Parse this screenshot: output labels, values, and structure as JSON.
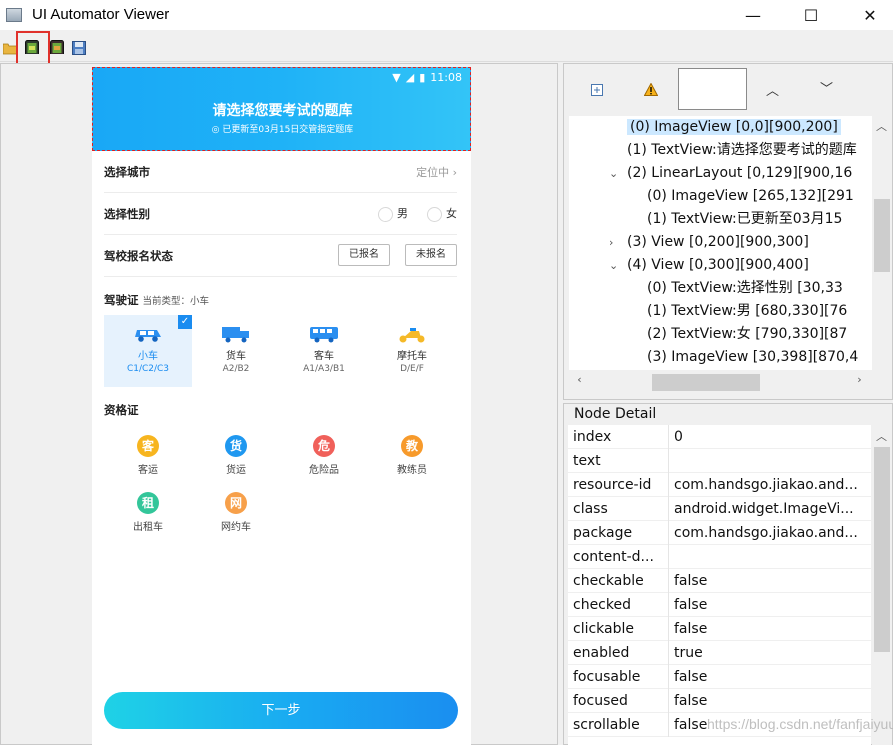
{
  "window": {
    "title": "UI Automator Viewer",
    "minimize": "—",
    "maximize": "☐",
    "close": "✕"
  },
  "toolbar": {
    "items": [
      {
        "name": "open-icon"
      },
      {
        "name": "device-screenshot-icon"
      },
      {
        "name": "device-screenshot-compressed-icon"
      },
      {
        "name": "save-icon"
      }
    ]
  },
  "phone": {
    "status_time": "11:08",
    "header_title": "请选择您要考试的题库",
    "header_sub": "已更新至03月15日交管指定题库",
    "rows": {
      "city_label": "选择城市",
      "city_value": "定位中",
      "gender_label": "选择性别",
      "gender_male": "男",
      "gender_female": "女",
      "school_label": "驾校报名状态",
      "school_btn1": "已报名",
      "school_btn2": "未报名"
    },
    "license": {
      "title": "驾驶证",
      "current": "当前类型：小车",
      "items": [
        {
          "name": "小车",
          "codes": "C1/C2/C3",
          "color": "#2b8ff0",
          "selected": true
        },
        {
          "name": "货车",
          "codes": "A2/B2",
          "color": "#2b8ff0",
          "selected": false
        },
        {
          "name": "客车",
          "codes": "A1/A3/B1",
          "color": "#2b8ff0",
          "selected": false
        },
        {
          "name": "摩托车",
          "codes": "D/E/F",
          "color": "#f5b928",
          "selected": false
        }
      ]
    },
    "qualification": {
      "title": "资格证",
      "items": [
        {
          "char": "客",
          "name": "客运",
          "color": "#f7b51f"
        },
        {
          "char": "货",
          "name": "货运",
          "color": "#1f98f0"
        },
        {
          "char": "危",
          "name": "危险品",
          "color": "#f0605a"
        },
        {
          "char": "教",
          "name": "教练员",
          "color": "#f79a2b"
        },
        {
          "char": "租",
          "name": "出租车",
          "color": "#33c69a"
        },
        {
          "char": "网",
          "name": "网约车",
          "color": "#f7a04a"
        }
      ]
    },
    "next_button": "下一步"
  },
  "tree": {
    "lines": [
      {
        "indent": 3,
        "arrow": "",
        "text": "(0) ImageView [0,0][900,200]",
        "selected": true
      },
      {
        "indent": 3,
        "arrow": "",
        "text": "(1) TextView:请选择您要考试的题库",
        "selected": false
      },
      {
        "indent": 3,
        "arrow": "⌄",
        "text": "(2) LinearLayout [0,129][900,16",
        "selected": false
      },
      {
        "indent": 4,
        "arrow": "",
        "text": "(0) ImageView [265,132][291",
        "selected": false
      },
      {
        "indent": 4,
        "arrow": "",
        "text": "(1) TextView:已更新至03月15",
        "selected": false
      },
      {
        "indent": 3,
        "arrow": "›",
        "text": "(3) View [0,200][900,300]",
        "selected": false
      },
      {
        "indent": 3,
        "arrow": "⌄",
        "text": "(4) View [0,300][900,400]",
        "selected": false
      },
      {
        "indent": 4,
        "arrow": "",
        "text": "(0) TextView:选择性别 [30,33",
        "selected": false
      },
      {
        "indent": 4,
        "arrow": "",
        "text": "(1) TextView:男 [680,330][76",
        "selected": false
      },
      {
        "indent": 4,
        "arrow": "",
        "text": "(2) TextView:女 [790,330][87",
        "selected": false
      },
      {
        "indent": 4,
        "arrow": "",
        "text": "(3) ImageView [30,398][870,4",
        "selected": false
      }
    ]
  },
  "detail": {
    "title": "Node Detail",
    "rows": [
      {
        "k": "index",
        "v": "0"
      },
      {
        "k": "text",
        "v": ""
      },
      {
        "k": "resource-id",
        "v": "com.handsgo.jiakao.and..."
      },
      {
        "k": "class",
        "v": "android.widget.ImageVi..."
      },
      {
        "k": "package",
        "v": "com.handsgo.jiakao.and..."
      },
      {
        "k": "content-d...",
        "v": ""
      },
      {
        "k": "checkable",
        "v": "false"
      },
      {
        "k": "checked",
        "v": "false"
      },
      {
        "k": "clickable",
        "v": "false"
      },
      {
        "k": "enabled",
        "v": "true"
      },
      {
        "k": "focusable",
        "v": "false"
      },
      {
        "k": "focused",
        "v": "false"
      },
      {
        "k": "scrollable",
        "v": "false"
      }
    ]
  },
  "watermark": "https://blog.csdn.net/fanfjaiyuu"
}
